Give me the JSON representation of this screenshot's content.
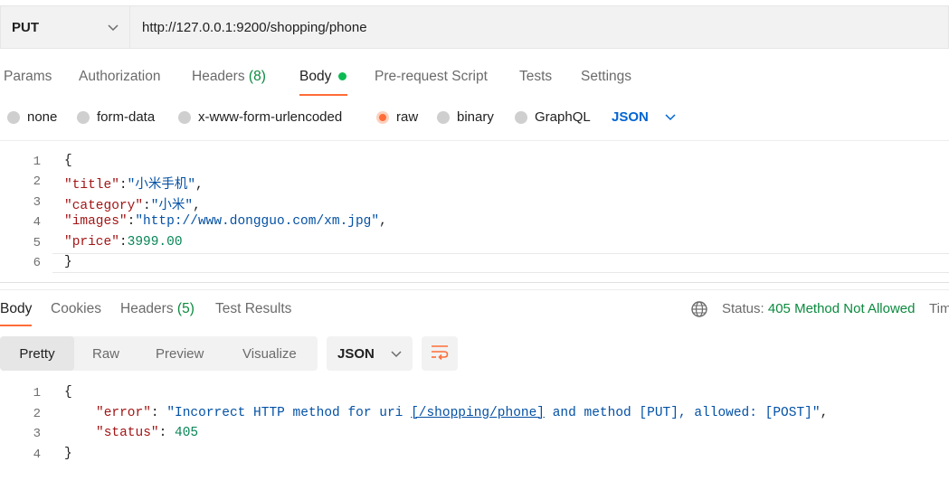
{
  "request": {
    "method": "PUT",
    "url": "http://127.0.0.1:9200/shopping/phone",
    "tabs": {
      "params": "Params",
      "authorization": "Authorization",
      "headers": "Headers",
      "headers_count": "(8)",
      "body": "Body",
      "pre_request_script": "Pre-request Script",
      "tests": "Tests",
      "settings": "Settings"
    },
    "body_types": {
      "none": "none",
      "form_data": "form-data",
      "urlencoded": "x-www-form-urlencoded",
      "raw": "raw",
      "binary": "binary",
      "graphql": "GraphQL"
    },
    "raw_format": "JSON",
    "line_numbers": [
      "1",
      "2",
      "3",
      "4",
      "5",
      "6"
    ],
    "code": {
      "open": "{",
      "title_key": "\"title\"",
      "title_val": "\"小米手机\"",
      "category_key": "\"category\"",
      "category_val": "\"小米\"",
      "images_key": "\"images\"",
      "images_val": "\"http://www.dongguo.com/xm.jpg\"",
      "price_key": "\"price\"",
      "price_val": "3999.00",
      "close": "}"
    }
  },
  "response": {
    "tabs": {
      "body": "Body",
      "cookies": "Cookies",
      "headers": "Headers",
      "headers_count": "(5)",
      "test_results": "Test Results"
    },
    "status_label": "Status:",
    "status_value": "405 Method Not Allowed",
    "time_label": "Tim",
    "view_modes": {
      "pretty": "Pretty",
      "raw": "Raw",
      "preview": "Preview",
      "visualize": "Visualize"
    },
    "format": "JSON",
    "line_numbers": [
      "1",
      "2",
      "3",
      "4"
    ],
    "code": {
      "open": "{",
      "error_key": "\"error\"",
      "error_val_pre": "\"Incorrect HTTP method for uri ",
      "error_val_link": "[/shopping/phone]",
      "error_val_post": " and method [PUT], allowed: [POST]\"",
      "status_key": "\"status\"",
      "status_val": "405",
      "close": "}"
    }
  },
  "colors": {
    "accent": "#ff6c37",
    "success": "#0b8a3e",
    "link_blue": "#0265d2"
  },
  "icons": {
    "method_chevron": "chevron-down-icon",
    "globe": "globe-icon",
    "wrap": "wrap-lines-icon"
  }
}
